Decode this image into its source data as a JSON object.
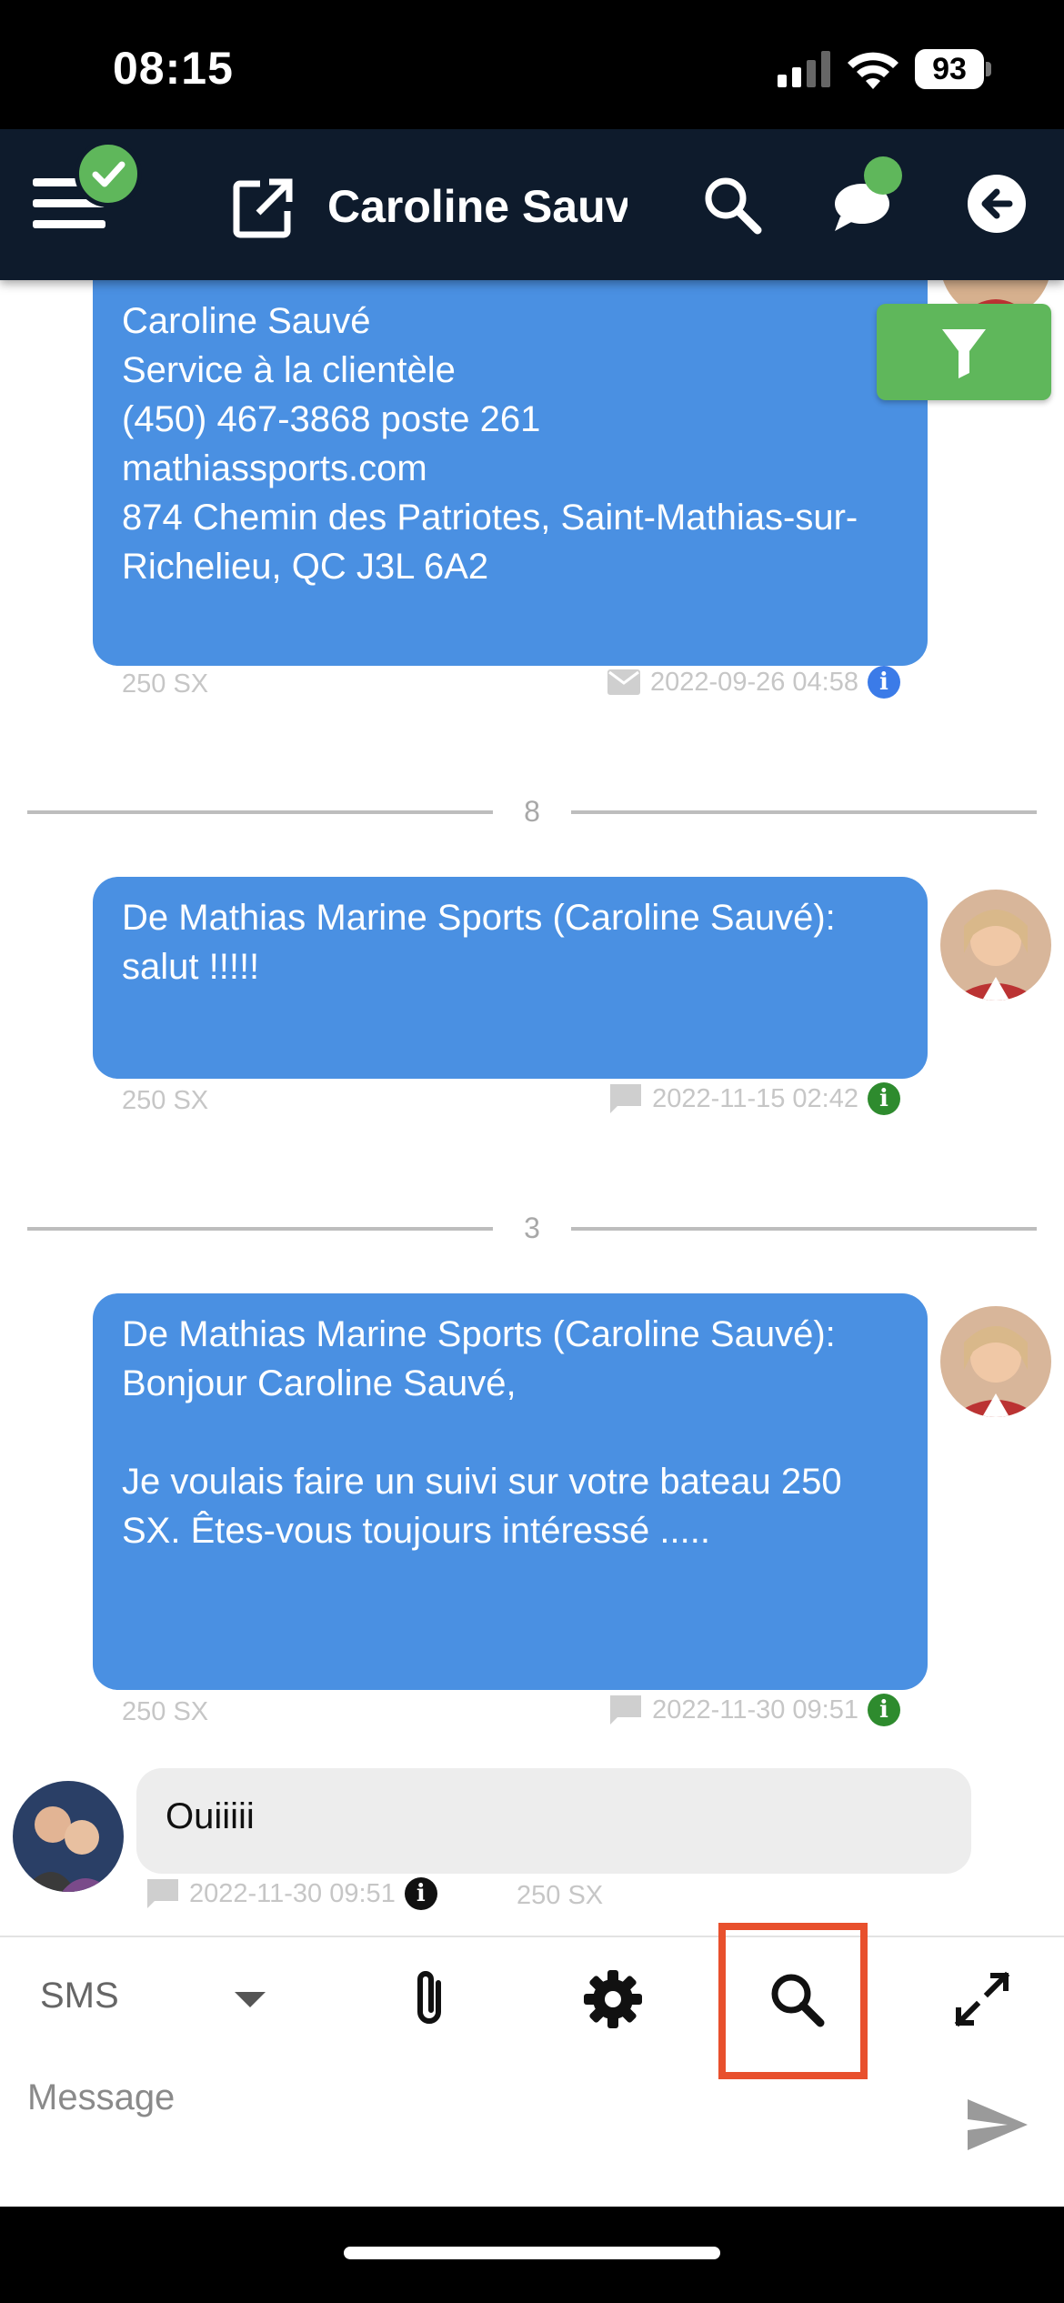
{
  "status_bar": {
    "time": "08:15",
    "battery": "93"
  },
  "header": {
    "title": "Caroline Sauvé"
  },
  "messages": [
    {
      "text": "Caroline Sauvé\nService à la clientèle\n(450) 467-3868 poste 261\nmathiassports.com\n874 Chemin des Patriotes, Saint-Mathias-sur-Richelieu, QC J3L 6A2\n",
      "tag": "250 SX",
      "timestamp": "2022-09-26 04:58"
    },
    {
      "text": "De Mathias Marine Sports (Caroline Sauvé):\nsalut !!!!!",
      "tag": "250 SX",
      "timestamp": "2022-11-15 02:42"
    },
    {
      "text": "De Mathias Marine Sports (Caroline Sauvé):\nBonjour Caroline Sauvé,\n\nJe voulais faire un suivi sur votre bateau 250 SX. Êtes-vous toujours intéressé .....",
      "tag": "250 SX",
      "timestamp": "2022-11-30 09:51"
    },
    {
      "text": "Ouiiiii",
      "tag": "250 SX",
      "timestamp": "2022-11-30 09:51"
    }
  ],
  "dividers": [
    "8",
    "3"
  ],
  "composer": {
    "channel": "SMS",
    "placeholder": "Message"
  },
  "colors": {
    "header_bg": "#0e1b2c",
    "bubble_out": "#4a90e2",
    "accent_green": "#5fb75b",
    "highlight": "#e8502d"
  }
}
